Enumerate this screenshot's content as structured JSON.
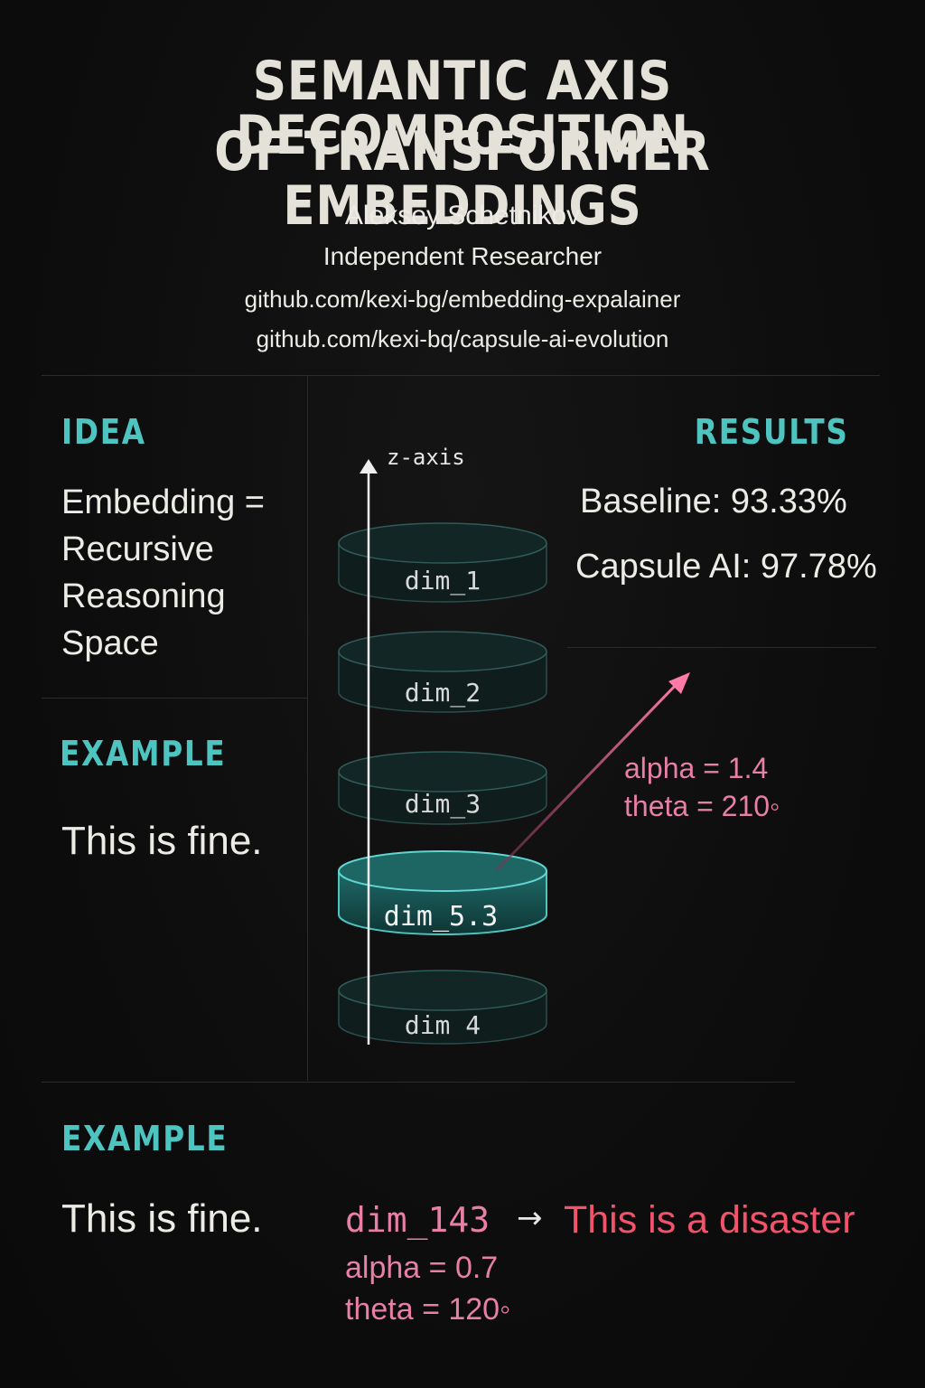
{
  "header": {
    "title_line1": "SEMANTIC AXIS DECOMPOSITION",
    "title_line2": "OF TRANSFORMER EMBEDDINGS",
    "author": "Aleksey Schetnikov",
    "affiliation": "Independent Researcher",
    "link1": "github.com/kexi-bg/embedding-expalainer",
    "link2": "github.com/kexi-bq/capsule-ai-evolution"
  },
  "idea": {
    "heading": "IDEA",
    "lines": [
      "Embedding =",
      "Recursive",
      "Reasoning",
      "Space"
    ]
  },
  "example_top": {
    "heading": "EXAMPLE",
    "text": "This is fine."
  },
  "diagram": {
    "axis_label": "z-axis",
    "layers": [
      "dim_1",
      "dim_2",
      "dim_3",
      "dim_5.3",
      "dim 4"
    ],
    "highlighted_layer": "dim_5.3",
    "vector_label_alpha": "alpha = 1.4",
    "vector_label_theta": "theta = 210◦",
    "colors": {
      "accent": "#4ec4c0",
      "vector": "#e87fa6"
    }
  },
  "results": {
    "heading": "RESULTS",
    "baseline": "Baseline: 93.33%",
    "capsule": "Capsule AI: 97.78%"
  },
  "example_bottom": {
    "heading": "EXAMPLE",
    "input": "This is fine.",
    "dim": "dim_143",
    "arrow": "→",
    "output": "This is a disaster",
    "alpha": "alpha = 0.7",
    "theta": "theta = 120◦",
    "colors": {
      "dim": "#e87fa6",
      "output": "#f2536a"
    }
  }
}
